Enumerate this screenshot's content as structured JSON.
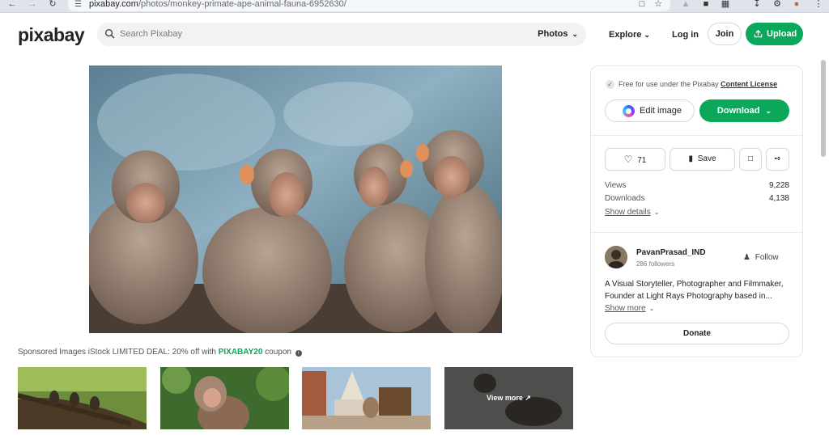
{
  "browser": {
    "url_host": "pixabay.com",
    "url_path": "/photos/monkey-primate-ape-animal-fauna-6952630/"
  },
  "header": {
    "logo": "pixabay",
    "search_placeholder": "Search Pixabay",
    "search_type": "Photos",
    "explore": "Explore",
    "login": "Log in",
    "join": "Join",
    "upload": "Upload"
  },
  "sponsored": {
    "prefix": "Sponsored Images iStock LIMITED DEAL: 20% off with ",
    "code": "PIXABAY20",
    "suffix": " coupon",
    "view_more": "View more"
  },
  "panel": {
    "license_text": "Free for use under the Pixabay ",
    "license_link": "Content License",
    "edit_image": "Edit image",
    "download": "Download",
    "likes": "71",
    "save": "Save",
    "views_label": "Views",
    "views_value": "9,228",
    "downloads_label": "Downloads",
    "downloads_value": "4,138",
    "show_details": "Show details",
    "user_name": "PavanPrasad_IND",
    "followers": "286 followers",
    "follow": "Follow",
    "bio": "A Visual Storyteller, Photographer and Filmmaker, Founder at Light Rays Photography based in...",
    "show_more": "Show more",
    "donate": "Donate"
  },
  "colors": {
    "accent": "#0aa85b"
  }
}
